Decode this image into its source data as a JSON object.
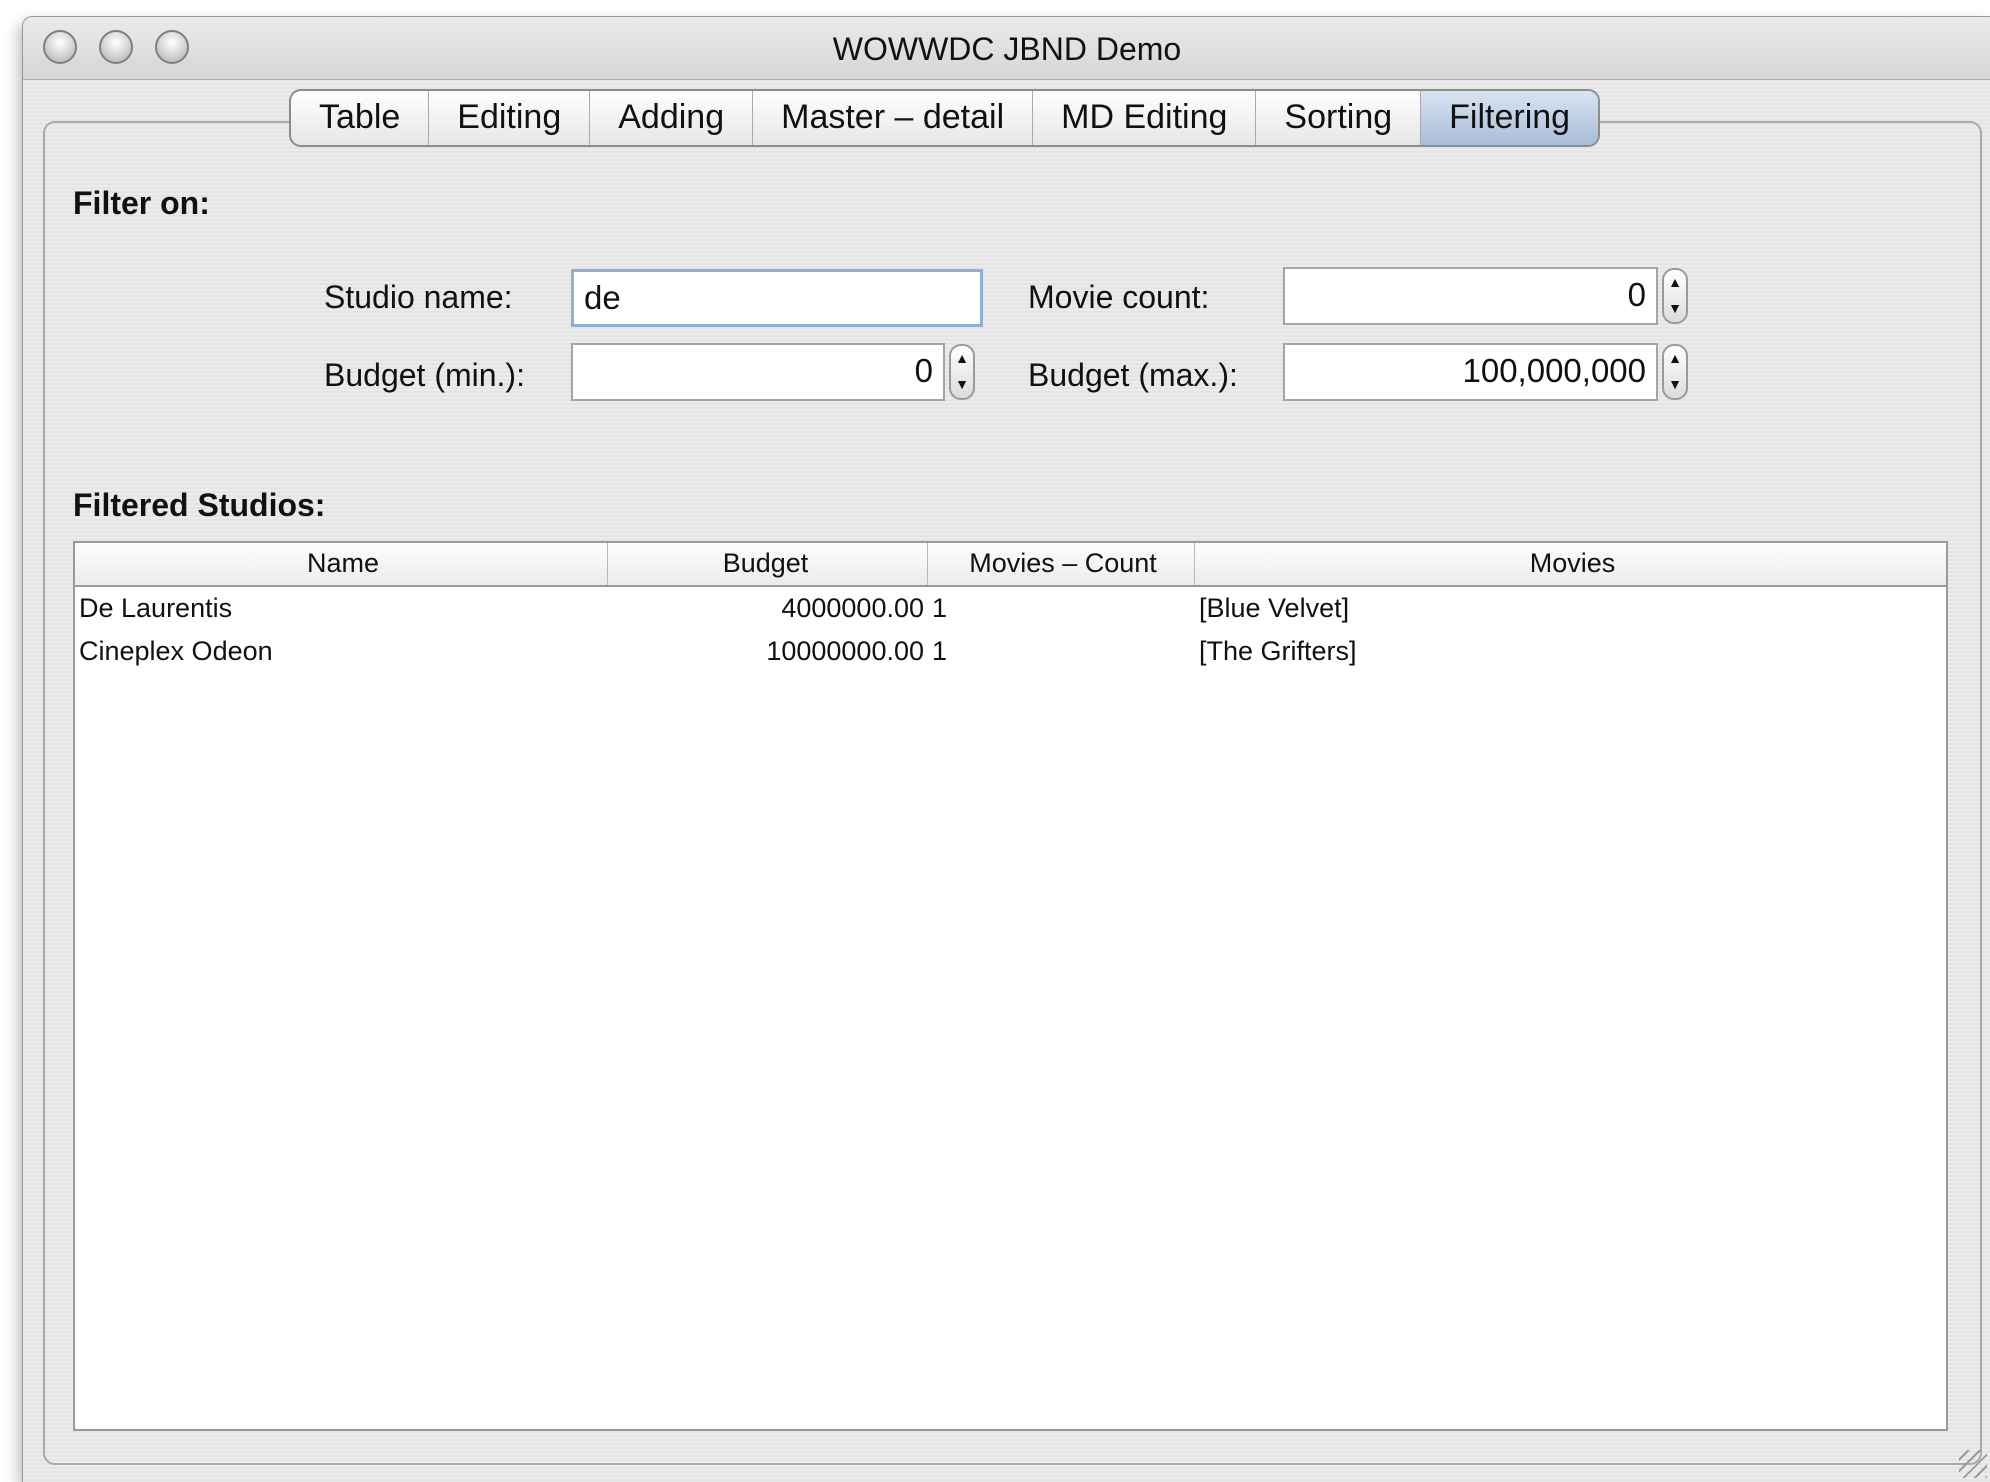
{
  "window": {
    "title": "WOWWDC JBND Demo"
  },
  "tabs": [
    {
      "label": "Table"
    },
    {
      "label": "Editing"
    },
    {
      "label": "Adding"
    },
    {
      "label": "Master – detail"
    },
    {
      "label": "MD Editing"
    },
    {
      "label": "Sorting"
    },
    {
      "label": "Filtering",
      "active": true
    }
  ],
  "filter": {
    "heading": "Filter on:",
    "studio_name": {
      "label": "Studio name:",
      "value": "de"
    },
    "movie_count": {
      "label": "Movie count:",
      "value": "0"
    },
    "budget_min": {
      "label": "Budget (min.):",
      "value": "0"
    },
    "budget_max": {
      "label": "Budget (max.):",
      "value": "100,000,000"
    }
  },
  "results": {
    "heading": "Filtered Studios:",
    "columns": [
      "Name",
      "Budget",
      "Movies – Count",
      "Movies"
    ],
    "rows": [
      [
        "De Laurentis",
        "4000000.00",
        "1",
        "[Blue Velvet]"
      ],
      [
        "Cineplex Odeon",
        "10000000.00",
        "1",
        "[The Grifters]"
      ]
    ]
  },
  "stepper_glyphs": {
    "up": "▲",
    "down": "▼"
  }
}
